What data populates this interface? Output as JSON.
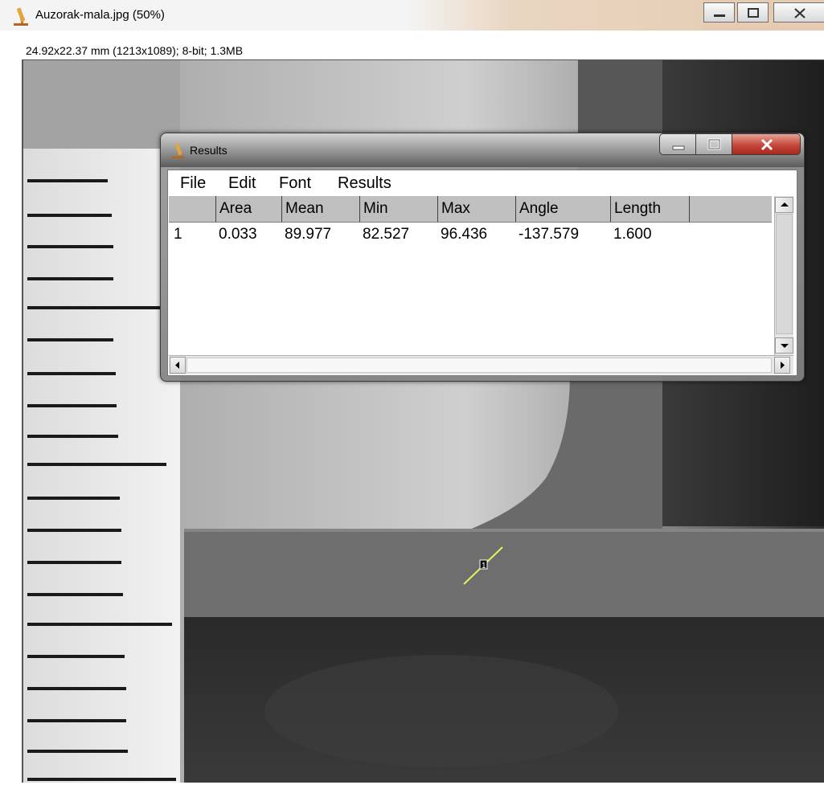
{
  "window": {
    "title": "Auzorak-mala.jpg (50%)",
    "image_info": "24.92x22.37 mm (1213x1089); 8-bit; 1.3MB"
  },
  "image": {
    "selection_label": "1"
  },
  "results": {
    "title": "Results",
    "menu": [
      "File",
      "Edit",
      "Font",
      "Results"
    ],
    "columns": [
      "",
      "Area",
      "Mean",
      "Min",
      "Max",
      "Angle",
      "Length"
    ],
    "rows": [
      [
        "1",
        "0.033",
        "89.977",
        "82.527",
        "96.436",
        "-137.579",
        "1.600"
      ]
    ]
  },
  "colors": {
    "close_button": "#c4473a",
    "selection_line": "#e8f060"
  }
}
